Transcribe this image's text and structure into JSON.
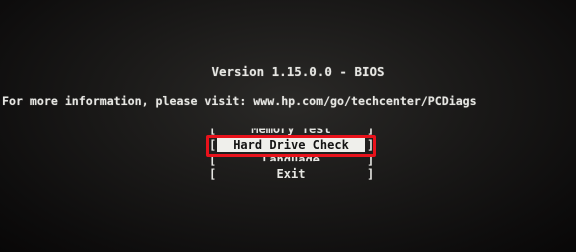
{
  "header": {
    "version": "Version 1.15.0.0 - BIOS",
    "info": "For more information, please visit: www.hp.com/go/techcenter/PCDiags"
  },
  "menu": {
    "bracket_open": "[",
    "bracket_close": "]",
    "items": [
      {
        "label": "Memory Test"
      },
      {
        "label": "Hard Drive Check",
        "selected": true
      },
      {
        "label": "Language"
      },
      {
        "label": "Exit"
      }
    ]
  },
  "colors": {
    "text": "#e6e6e2",
    "selection_bg": "#efefeb",
    "highlight_border": "#e8121b"
  }
}
